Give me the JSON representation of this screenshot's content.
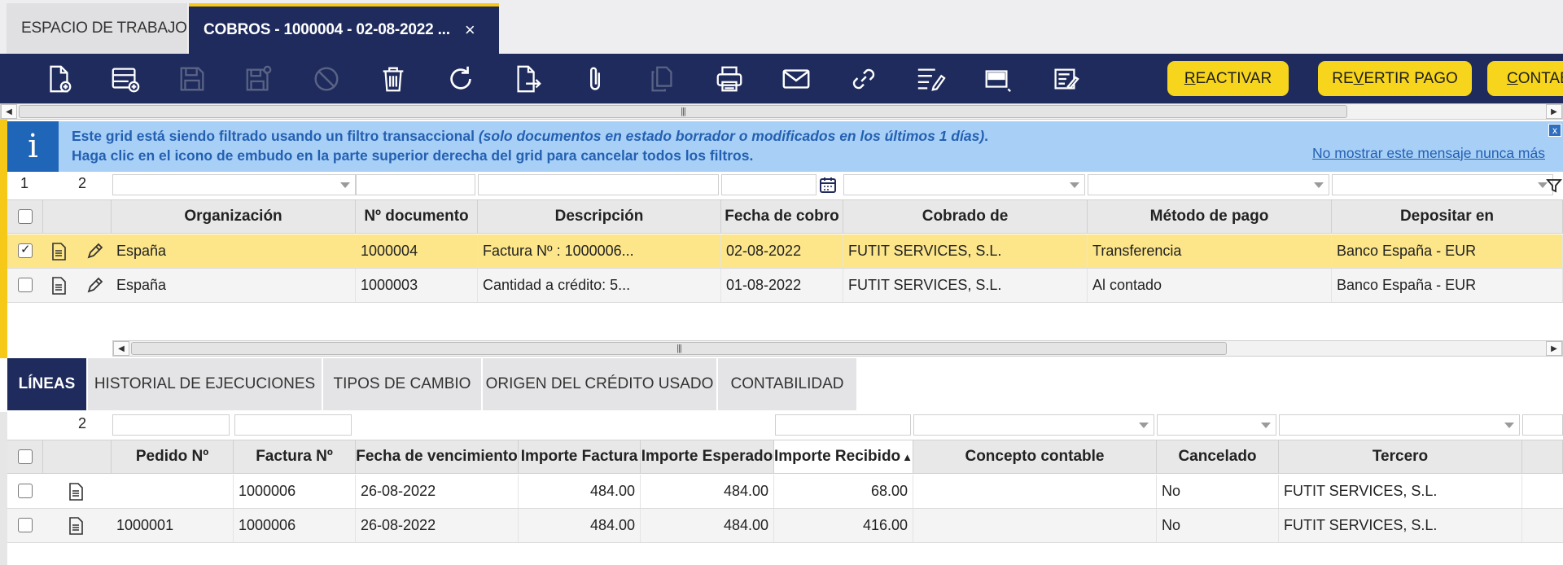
{
  "tabs": {
    "workspace": "ESPACIO DE TRABAJO",
    "active": "COBROS - 1000004 - 02-08-2022 ...",
    "close": "×"
  },
  "toolbar": {
    "icons": [
      "new-document-icon",
      "new-row-icon",
      "save-icon",
      "save-close-icon",
      "undo-icon",
      "delete-icon",
      "refresh-icon",
      "export-icon",
      "attachment-icon",
      "clone-icon",
      "print-icon",
      "email-icon",
      "link-icon",
      "audit-icon",
      "form-view-icon",
      "notes-icon"
    ],
    "btn_reactivar_pre": "",
    "btn_reactivar_u": "R",
    "btn_reactivar_post": "EACTIVAR",
    "btn_revertir_pre": "RE",
    "btn_revertir_u": "V",
    "btn_revertir_post": "ERTIR PAGO",
    "btn_contab_pre": "",
    "btn_contab_u": "C",
    "btn_contab_post": "ONTAB"
  },
  "message": {
    "line1_start": "Este grid está siendo filtrado usando un filtro transaccional ",
    "line1_italic": "(solo documentos en estado borrador o modificados en los últimos 1 días)",
    "line1_end": ".",
    "line2": "Haga clic en el icono de embudo en la parte superior derecha del grid para cancelar todos los filtros.",
    "link": "No mostrar este mensaje nunca más",
    "icon": "i",
    "close": "x"
  },
  "header_grid": {
    "selected_count": "1",
    "row_count": "2",
    "columns": [
      "Organización",
      "Nº documento",
      "Descripción",
      "Fecha de cobro",
      "Cobrado de",
      "Método de pago",
      "Depositar en"
    ],
    "rows": [
      {
        "org": "España",
        "doc": "1000004",
        "desc": "Factura Nº : 1000006...",
        "date": "02-08-2022",
        "from": "FUTIT SERVICES, S.L.",
        "method": "Transferencia",
        "deposit": "Banco España - EUR",
        "checked": true
      },
      {
        "org": "España",
        "doc": "1000003",
        "desc": "Cantidad a crédito: 5...",
        "date": "01-08-2022",
        "from": "FUTIT SERVICES, S.L.",
        "method": "Al contado",
        "deposit": "Banco España - EUR",
        "checked": false
      }
    ]
  },
  "subtabs": [
    "LÍNEAS",
    "HISTORIAL DE EJECUCIONES",
    "TIPOS DE CAMBIO",
    "ORIGEN DEL CRÉDITO USADO",
    "CONTABILIDAD"
  ],
  "lines_grid": {
    "row_count": "2",
    "columns": [
      "Pedido Nº",
      "Factura Nº",
      "Fecha de vencimiento",
      "Importe Factura",
      "Importe Esperado",
      "Importe Recibido",
      "Concepto contable",
      "Cancelado",
      "Tercero"
    ],
    "sort_indicator": "▲",
    "rows": [
      {
        "order": "",
        "invoice": "1000006",
        "due": "26-08-2022",
        "inv_amt": "484.00",
        "exp_amt": "484.00",
        "rec_amt": "68.00",
        "concept": "",
        "cancel": "No",
        "party": "FUTIT SERVICES, S.L."
      },
      {
        "order": "1000001",
        "invoice": "1000006",
        "due": "26-08-2022",
        "inv_amt": "484.00",
        "exp_amt": "484.00",
        "rec_amt": "416.00",
        "concept": "",
        "cancel": "No",
        "party": "FUTIT SERVICES, S.L."
      }
    ]
  },
  "scrollbar": {
    "grip": "|||"
  },
  "colors": {
    "navy": "#1e2b5c",
    "yellow": "#f7d51d",
    "selected_row": "#fde68a",
    "info_bg": "#a8d0f7"
  }
}
